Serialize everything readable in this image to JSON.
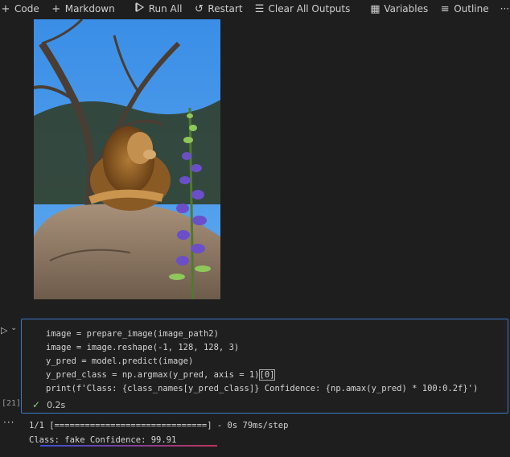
{
  "toolbar": {
    "code": "Code",
    "markdown": "Markdown",
    "run_all": "Run All",
    "restart": "Restart",
    "clear_outputs": "Clear All Outputs",
    "variables": "Variables",
    "outline": "Outline",
    "more": "···"
  },
  "cell": {
    "exec_count": "[21]",
    "duration": "0.2s",
    "lines": {
      "l1": "image = prepare_image(image_path2)",
      "l2": "image = image.reshape(-1, 128, 128, 3)",
      "l3": "y_pred = model.predict(image)",
      "l4a": "y_pred_class = np.argmax(y_pred, axis = 1)",
      "l4b": "[0]",
      "l5": "print(f'Class: {class_names[y_pred_class]} Confidence: {np.amax(y_pred) * 100:0.2f}')"
    }
  },
  "output": {
    "progress": "1/1 [==============================] - 0s 79ms/step",
    "result": "Class: fake Confidence: 99.91"
  },
  "image": {
    "description_icon": "lion-photo"
  },
  "colors": {
    "background": "#1e1e1e",
    "cell_border": "#3c78c8",
    "check": "#89d185"
  }
}
